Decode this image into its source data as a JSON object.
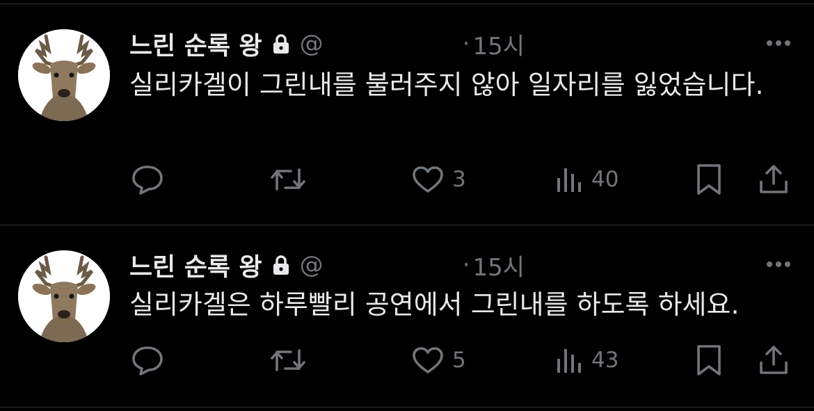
{
  "tweets": [
    {
      "display_name": "느린 순록 왕",
      "handle": "@",
      "separator": "·",
      "time": "15시",
      "text": "실리카겔이 그린내를 불러주지 않아 일자리를 잃었습니다.",
      "avatar_icon": "deer-avatar",
      "actions": {
        "reply": "",
        "retweet": "",
        "likes": "3",
        "views": "40",
        "bookmark": "",
        "share": ""
      }
    },
    {
      "display_name": "느린 순록 왕",
      "handle": "@",
      "separator": "·",
      "time": "15시",
      "text": "실리카겔은 하루빨리 공연에서 그린내를 하도록 하세요.",
      "avatar_icon": "deer-avatar",
      "actions": {
        "reply": "",
        "retweet": "",
        "likes": "5",
        "views": "43",
        "bookmark": "",
        "share": ""
      }
    }
  ],
  "colors": {
    "background": "#000000",
    "text": "#e7e9ea",
    "secondary": "#71767b",
    "divider": "#2f3336"
  }
}
